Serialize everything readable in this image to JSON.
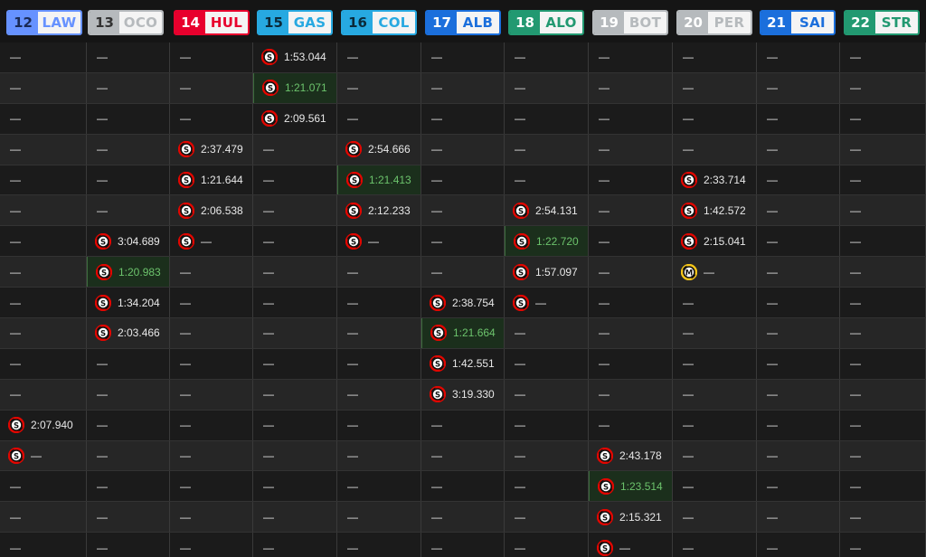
{
  "drivers": [
    {
      "num": "12",
      "code": "LAW",
      "color": "#6692ff",
      "num_color": "#1a2a55"
    },
    {
      "num": "13",
      "code": "OCO",
      "color": "#b6babd",
      "num_color": "#333333"
    },
    {
      "num": "14",
      "code": "HUL",
      "color": "#e8002d",
      "num_color": "#ffffff"
    },
    {
      "num": "15",
      "code": "GAS",
      "color": "#27a9e1",
      "num_color": "#0b2a3a"
    },
    {
      "num": "16",
      "code": "COL",
      "color": "#27a9e1",
      "num_color": "#0b2a3a"
    },
    {
      "num": "17",
      "code": "ALB",
      "color": "#1b6fdc",
      "num_color": "#ffffff"
    },
    {
      "num": "18",
      "code": "ALO",
      "color": "#229971",
      "num_color": "#ffffff"
    },
    {
      "num": "19",
      "code": "BOT",
      "color": "#b6babd",
      "num_color": "#ffffff"
    },
    {
      "num": "20",
      "code": "PER",
      "color": "#b6babd",
      "num_color": "#ffffff"
    },
    {
      "num": "21",
      "code": "SAI",
      "color": "#1b6fdc",
      "num_color": "#ffffff"
    },
    {
      "num": "22",
      "code": "STR",
      "color": "#229971",
      "num_color": "#ffffff"
    }
  ],
  "dash": "—",
  "tyre_letters": {
    "soft": "S",
    "medium": "M"
  },
  "tyre_colors": {
    "soft": "#e10600",
    "medium": "#f5c518"
  },
  "rows": [
    [
      null,
      null,
      null,
      {
        "tyre": "soft",
        "time": "1:53.044"
      },
      null,
      null,
      null,
      null,
      null,
      null,
      null
    ],
    [
      null,
      null,
      null,
      {
        "tyre": "soft",
        "time": "1:21.071",
        "best": true
      },
      null,
      null,
      null,
      null,
      null,
      null,
      null
    ],
    [
      null,
      null,
      null,
      {
        "tyre": "soft",
        "time": "2:09.561"
      },
      null,
      null,
      null,
      null,
      null,
      null,
      null
    ],
    [
      null,
      null,
      {
        "tyre": "soft",
        "time": "2:37.479"
      },
      null,
      {
        "tyre": "soft",
        "time": "2:54.666"
      },
      null,
      null,
      null,
      null,
      null,
      null
    ],
    [
      null,
      null,
      {
        "tyre": "soft",
        "time": "1:21.644"
      },
      null,
      {
        "tyre": "soft",
        "time": "1:21.413",
        "best": true
      },
      null,
      null,
      null,
      {
        "tyre": "soft",
        "time": "2:33.714"
      },
      null,
      null
    ],
    [
      null,
      null,
      {
        "tyre": "soft",
        "time": "2:06.538"
      },
      null,
      {
        "tyre": "soft",
        "time": "2:12.233"
      },
      null,
      {
        "tyre": "soft",
        "time": "2:54.131"
      },
      null,
      {
        "tyre": "soft",
        "time": "1:42.572"
      },
      null,
      null
    ],
    [
      null,
      {
        "tyre": "soft",
        "time": "3:04.689"
      },
      {
        "tyre": "soft",
        "time": "—"
      },
      null,
      {
        "tyre": "soft",
        "time": "—"
      },
      null,
      {
        "tyre": "soft",
        "time": "1:22.720",
        "best": true
      },
      null,
      {
        "tyre": "soft",
        "time": "2:15.041"
      },
      null,
      null
    ],
    [
      null,
      {
        "tyre": "soft",
        "time": "1:20.983",
        "best": true
      },
      null,
      null,
      null,
      null,
      {
        "tyre": "soft",
        "time": "1:57.097"
      },
      null,
      {
        "tyre": "medium",
        "time": "—"
      },
      null,
      null
    ],
    [
      null,
      {
        "tyre": "soft",
        "time": "1:34.204"
      },
      null,
      null,
      null,
      {
        "tyre": "soft",
        "time": "2:38.754"
      },
      {
        "tyre": "soft",
        "time": "—"
      },
      null,
      null,
      null,
      null
    ],
    [
      null,
      {
        "tyre": "soft",
        "time": "2:03.466"
      },
      null,
      null,
      null,
      {
        "tyre": "soft",
        "time": "1:21.664",
        "best": true
      },
      null,
      null,
      null,
      null,
      null
    ],
    [
      null,
      null,
      null,
      null,
      null,
      {
        "tyre": "soft",
        "time": "1:42.551"
      },
      null,
      null,
      null,
      null,
      null
    ],
    [
      null,
      null,
      null,
      null,
      null,
      {
        "tyre": "soft",
        "time": "3:19.330"
      },
      null,
      null,
      null,
      null,
      null
    ],
    [
      {
        "tyre": "soft",
        "time": "2:07.940"
      },
      null,
      null,
      null,
      null,
      null,
      null,
      null,
      null,
      null,
      null
    ],
    [
      {
        "tyre": "soft",
        "time": "—"
      },
      null,
      null,
      null,
      null,
      null,
      null,
      {
        "tyre": "soft",
        "time": "2:43.178"
      },
      null,
      null,
      null
    ],
    [
      null,
      null,
      null,
      null,
      null,
      null,
      null,
      {
        "tyre": "soft",
        "time": "1:23.514",
        "best": true
      },
      null,
      null,
      null
    ],
    [
      null,
      null,
      null,
      null,
      null,
      null,
      null,
      {
        "tyre": "soft",
        "time": "2:15.321"
      },
      null,
      null,
      null
    ],
    [
      null,
      null,
      null,
      null,
      null,
      null,
      null,
      {
        "tyre": "soft",
        "time": "—"
      },
      null,
      null,
      null
    ]
  ]
}
